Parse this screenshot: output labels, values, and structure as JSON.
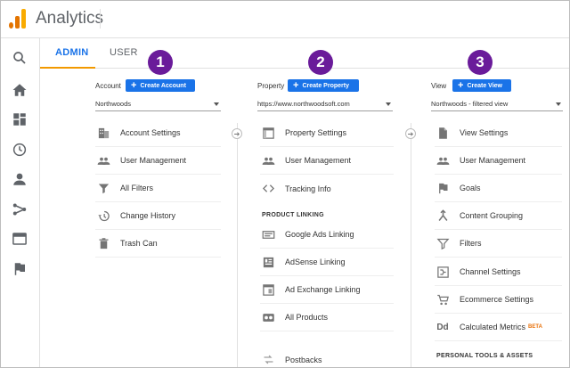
{
  "app": {
    "title": "Analytics"
  },
  "tabs": [
    {
      "label": "ADMIN"
    },
    {
      "label": "USER"
    }
  ],
  "rail": {
    "icons": [
      "search-icon",
      "home-icon",
      "customization-icon",
      "realtime-clock-icon",
      "audience-person-icon",
      "acquisition-icon",
      "behavior-icon",
      "conversions-flag-icon"
    ]
  },
  "badges": [
    "1",
    "2",
    "3"
  ],
  "account": {
    "label": "Account",
    "create_label": "Create Account",
    "selected": "Northwoods",
    "items": [
      {
        "label": "Account Settings",
        "icon": "building-icon"
      },
      {
        "label": "User Management",
        "icon": "people-icon"
      },
      {
        "label": "All Filters",
        "icon": "filter-icon"
      },
      {
        "label": "Change History",
        "icon": "history-icon"
      },
      {
        "label": "Trash Can",
        "icon": "trash-icon"
      }
    ]
  },
  "property": {
    "label": "Property",
    "create_label": "Create Property",
    "selected": "https://www.northwoodsoft.com",
    "items": [
      {
        "label": "Property Settings",
        "icon": "window-icon"
      },
      {
        "label": "User Management",
        "icon": "people-icon"
      },
      {
        "label": "Tracking Info",
        "icon": "code-icon"
      }
    ],
    "product_linking_heading": "PRODUCT LINKING",
    "linking_items": [
      {
        "label": "Google Ads Linking",
        "icon": "ads-icon"
      },
      {
        "label": "AdSense Linking",
        "icon": "adsense-icon"
      },
      {
        "label": "Ad Exchange Linking",
        "icon": "ad-exchange-icon"
      },
      {
        "label": "All Products",
        "icon": "all-products-icon"
      },
      {
        "label": "Postbacks",
        "icon": "postbacks-icon"
      }
    ]
  },
  "view": {
    "label": "View",
    "create_label": "Create View",
    "selected": "Northwoods - filtered view",
    "items": [
      {
        "label": "View Settings",
        "icon": "document-icon"
      },
      {
        "label": "User Management",
        "icon": "people-icon"
      },
      {
        "label": "Goals",
        "icon": "goal-flag-icon"
      },
      {
        "label": "Content Grouping",
        "icon": "content-grouping-icon"
      },
      {
        "label": "Filters",
        "icon": "filter-icon"
      },
      {
        "label": "Channel Settings",
        "icon": "channel-settings-icon"
      },
      {
        "label": "Ecommerce Settings",
        "icon": "cart-icon"
      },
      {
        "label": "Calculated Metrics",
        "icon": "dd-icon",
        "badge": "BETA"
      }
    ],
    "personal_heading": "PERSONAL TOOLS & ASSETS"
  },
  "colors": {
    "accent": "#1a73e8",
    "tab_underline": "#f29900",
    "badge": "#6a1b9a",
    "logo": "#f9ab00",
    "icon": "#5f6368"
  }
}
